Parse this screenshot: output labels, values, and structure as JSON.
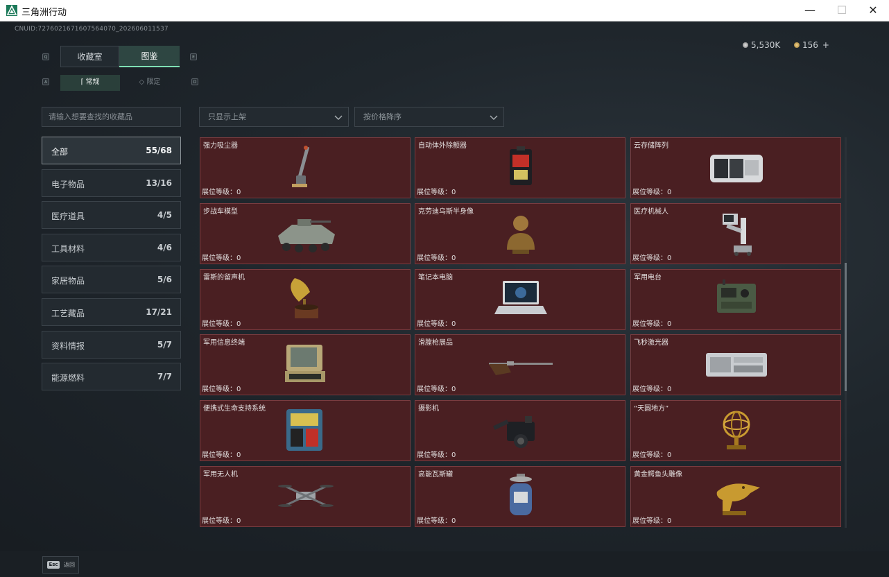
{
  "window": {
    "title": "三角洲行动"
  },
  "header": {
    "uid": "CNUID:7276021671607564070_202606011537",
    "currency_silver": "5,530K",
    "currency_gold": "156",
    "currency_plus": "+"
  },
  "tabs": {
    "collection": "收藏室",
    "catalog": "图鉴",
    "normal": "常规",
    "limited": "限定"
  },
  "search": {
    "placeholder": "请输入想要查找的收藏品"
  },
  "filters": {
    "shelf": "只显示上架",
    "sort": "按价格降序"
  },
  "categories": [
    {
      "label": "全部",
      "count": "55/68"
    },
    {
      "label": "电子物品",
      "count": "13/16"
    },
    {
      "label": "医疗道具",
      "count": "4/5"
    },
    {
      "label": "工具材料",
      "count": "4/6"
    },
    {
      "label": "家居物品",
      "count": "5/6"
    },
    {
      "label": "工艺藏品",
      "count": "17/21"
    },
    {
      "label": "资料情报",
      "count": "5/7"
    },
    {
      "label": "能源燃料",
      "count": "7/7"
    }
  ],
  "items": [
    {
      "name": "强力吸尘器",
      "level": "展位等级：0",
      "icon": "vacuum-cleaner"
    },
    {
      "name": "自动体外除颤器",
      "level": "展位等级：0",
      "icon": "defibrillator"
    },
    {
      "name": "云存储阵列",
      "level": "展位等级：0",
      "icon": "storage-array"
    },
    {
      "name": "步战车模型",
      "level": "展位等级：0",
      "icon": "ifv-model"
    },
    {
      "name": "克劳迪乌斯半身像",
      "level": "展位等级：0",
      "icon": "bust"
    },
    {
      "name": "医疗机械人",
      "level": "展位等级：0",
      "icon": "medical-robot"
    },
    {
      "name": "雷斯的留声机",
      "level": "展位等级：0",
      "icon": "gramophone"
    },
    {
      "name": "笔记本电脑",
      "level": "展位等级：0",
      "icon": "laptop"
    },
    {
      "name": "军用电台",
      "level": "展位等级：0",
      "icon": "military-radio"
    },
    {
      "name": "军用信息终端",
      "level": "展位等级：0",
      "icon": "info-terminal"
    },
    {
      "name": "滑膛枪展品",
      "level": "展位等级：0",
      "icon": "musket"
    },
    {
      "name": "飞秒激光器",
      "level": "展位等级：0",
      "icon": "laser"
    },
    {
      "name": "便携式生命支持系统",
      "level": "展位等级：0",
      "icon": "life-support"
    },
    {
      "name": "摄影机",
      "level": "展位等级：0",
      "icon": "camera"
    },
    {
      "name": "“天圆地方”",
      "level": "展位等级：0",
      "icon": "armillary-sphere"
    },
    {
      "name": "军用无人机",
      "level": "展位等级：0",
      "icon": "drone"
    },
    {
      "name": "高能瓦斯罐",
      "level": "展位等级：0",
      "icon": "gas-canister"
    },
    {
      "name": "黄金鳄鱼头雕像",
      "level": "展位等级：0",
      "icon": "gold-crocodile-head"
    }
  ],
  "footer": {
    "esc_key": "Esc",
    "esc_label": "返回"
  },
  "colors": {
    "card_bg": "#4a1f22",
    "card_border": "#7a3c40",
    "accent": "#7fe0b4"
  }
}
